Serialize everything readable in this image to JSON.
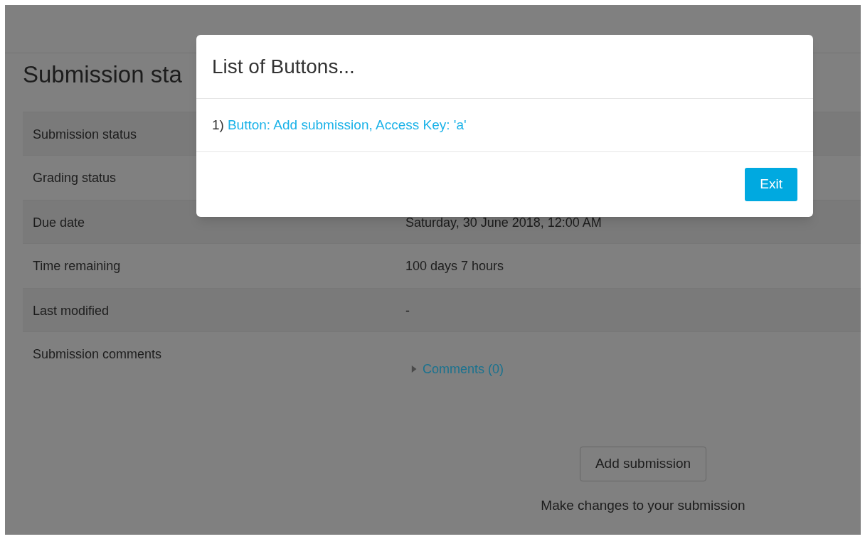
{
  "page_title": "Submission sta",
  "rows": [
    {
      "kind": "text",
      "label": "Submission status"
    },
    {
      "kind": "text",
      "label": "Grading status"
    },
    {
      "kind": "text",
      "label": "Due date",
      "value": "Saturday, 30 June 2018, 12:00 AM"
    },
    {
      "kind": "text",
      "label": "Time remaining",
      "value": "100 days 7 hours"
    },
    {
      "kind": "text",
      "label": "Last modified",
      "value": "-"
    },
    {
      "kind": "comments",
      "label": "Submission comments",
      "link": "Comments (0)",
      "expanded": false
    }
  ],
  "action": {
    "button": "Add submission",
    "caption": "Make changes to your submission"
  },
  "modal": {
    "title": "List of Buttons...",
    "items": [
      {
        "number": "1)",
        "text": "Button: Add submission, Access Key: 'a'"
      }
    ],
    "buttons": [
      "Exit"
    ]
  }
}
